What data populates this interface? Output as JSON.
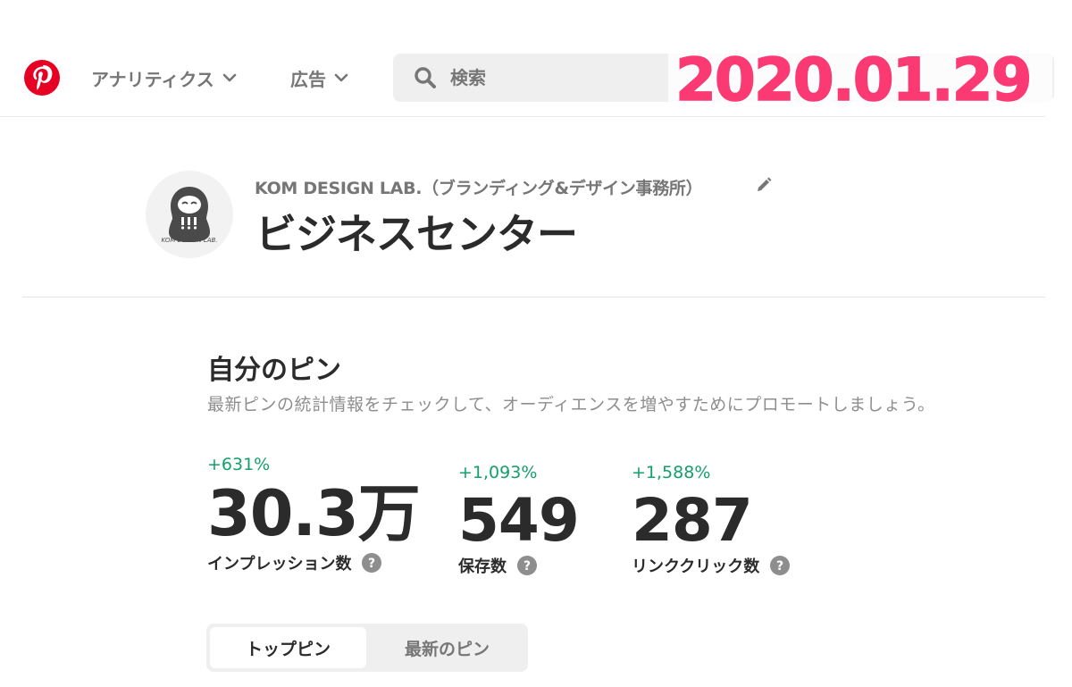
{
  "colors": {
    "brand": "#e60023",
    "date_overlay": "#fb3a74",
    "positive_change": "#14a06a",
    "muted_text": "#767676"
  },
  "header": {
    "logo_icon": "pinterest-logo-icon",
    "nav": [
      {
        "label": "アナリティクス",
        "icon": "chevron-down-icon"
      },
      {
        "label": "広告",
        "icon": "chevron-down-icon"
      }
    ],
    "search": {
      "placeholder": "検索",
      "icon": "search-icon"
    },
    "date_overlay": "2020.01.29"
  },
  "profile": {
    "avatar_text": "KOM DESIGN LAB.",
    "account_name": "KOM DESIGN LAB.（ブランディング&デザイン事務所）",
    "page_title": "ビジネスセンター",
    "edit_icon": "pencil-icon"
  },
  "my_pins": {
    "title": "自分のピン",
    "subtitle": "最新ピンの統計情報をチェックして、オーディエンスを増やすためにプロモートしましょう。",
    "stats": [
      {
        "change": "+631%",
        "value": "30.3万",
        "label": "インプレッション数",
        "icon": "help-icon"
      },
      {
        "change": "+1,093%",
        "value": "549",
        "label": "保存数",
        "icon": "help-icon"
      },
      {
        "change": "+1,588%",
        "value": "287",
        "label": "リンククリック数",
        "icon": "help-icon"
      }
    ],
    "tabs": [
      {
        "label": "トップピン",
        "selected": true
      },
      {
        "label": "最新のピン",
        "selected": false
      }
    ]
  }
}
